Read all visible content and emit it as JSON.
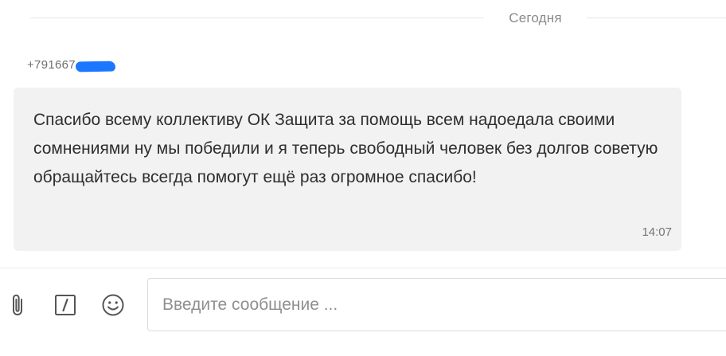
{
  "date_separator": {
    "label": "Сегодня"
  },
  "message": {
    "sender": "+791667",
    "text": "Спасибо всему коллективу ОК Защита за помощь всем надоедала своими сомнениями ну мы победили и я теперь свободный человек без долгов советую обращайтесь всегда помогут ещё раз огромное спасибо!",
    "time": "14:07"
  },
  "composer": {
    "placeholder": "Введите сообщение ...",
    "value": "",
    "icons": {
      "attach": "paperclip-icon",
      "command": "slash-box-icon",
      "emoji": "smiley-icon"
    }
  },
  "colors": {
    "bubble_bg": "#f2f2f2",
    "redaction": "#1c77ff",
    "muted_text": "#8a8a8a"
  }
}
